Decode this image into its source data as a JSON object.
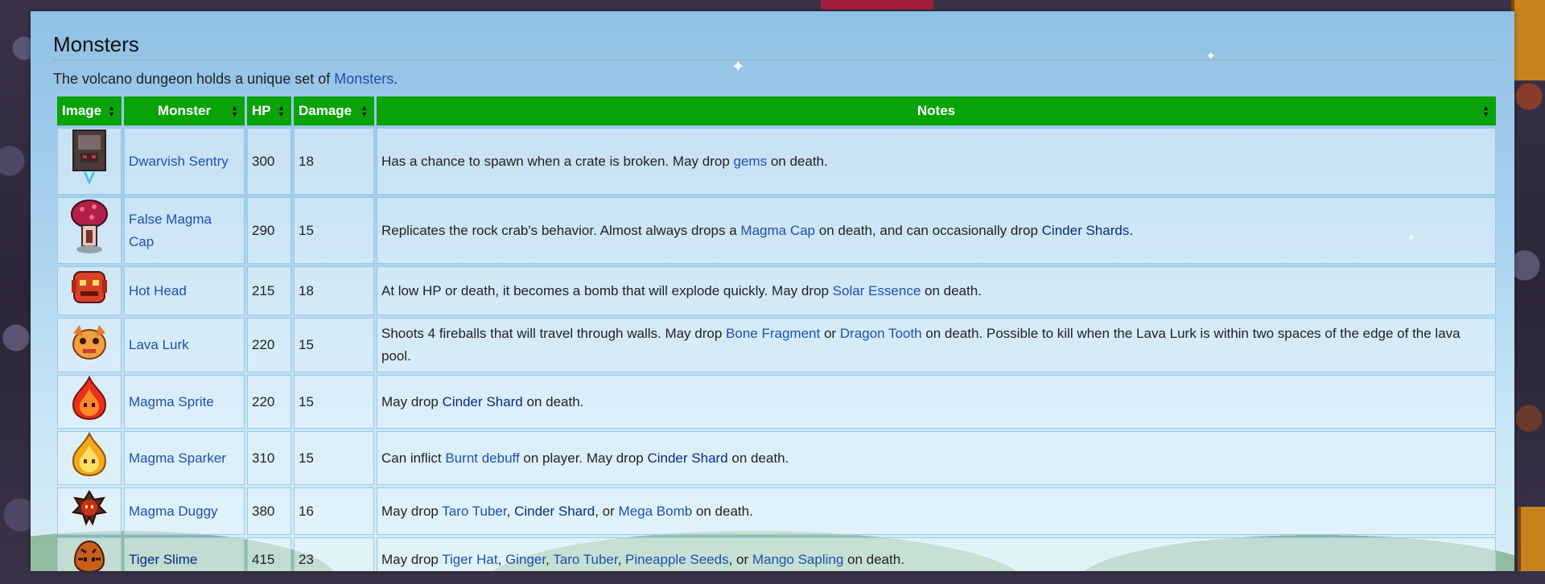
{
  "section": {
    "title": "Monsters",
    "intro_text": "The volcano dungeon holds a unique set of ",
    "intro_link": "Monsters",
    "intro_end": "."
  },
  "table": {
    "headers": {
      "image": "Image",
      "monster": "Monster",
      "hp": "HP",
      "damage": "Damage",
      "notes": "Notes"
    },
    "rows": [
      {
        "name": "Dwarvish Sentry",
        "hp": "300",
        "damage": "18",
        "icon": "dwarvish-sentry-sprite",
        "notes": [
          {
            "t": "Has a chance to spawn when a crate is broken. May drop "
          },
          {
            "t": "gems",
            "link": true
          },
          {
            "t": " on death."
          }
        ]
      },
      {
        "name": "False Magma Cap",
        "hp": "290",
        "damage": "15",
        "icon": "false-magma-cap-sprite",
        "notes": [
          {
            "t": "Replicates the rock crab's behavior. Almost always drops a "
          },
          {
            "t": "Magma Cap",
            "link": true
          },
          {
            "t": " on death, and can occasionally drop "
          },
          {
            "t": "Cinder Shards",
            "link": true,
            "dark": true
          },
          {
            "t": "."
          }
        ]
      },
      {
        "name": "Hot Head",
        "hp": "215",
        "damage": "18",
        "icon": "hot-head-sprite",
        "notes": [
          {
            "t": "At low HP or death, it becomes a bomb that will explode quickly. May drop "
          },
          {
            "t": "Solar Essence",
            "link": true
          },
          {
            "t": " on death."
          }
        ]
      },
      {
        "name": "Lava Lurk",
        "hp": "220",
        "damage": "15",
        "icon": "lava-lurk-sprite",
        "notes": [
          {
            "t": "Shoots 4 fireballs that will travel through walls. May drop "
          },
          {
            "t": "Bone Fragment",
            "link": true
          },
          {
            "t": " or "
          },
          {
            "t": "Dragon Tooth",
            "link": true
          },
          {
            "t": " on death. Possible to kill when the Lava Lurk is within two spaces of the edge of the lava pool."
          }
        ]
      },
      {
        "name": "Magma Sprite",
        "hp": "220",
        "damage": "15",
        "icon": "magma-sprite-sprite",
        "notes": [
          {
            "t": "May drop "
          },
          {
            "t": "Cinder Shard",
            "link": true,
            "dark": true
          },
          {
            "t": " on death."
          }
        ]
      },
      {
        "name": "Magma Sparker",
        "hp": "310",
        "damage": "15",
        "icon": "magma-sparker-sprite",
        "notes": [
          {
            "t": "Can inflict "
          },
          {
            "t": "Burnt debuff",
            "link": true
          },
          {
            "t": " on player. May drop "
          },
          {
            "t": "Cinder Shard",
            "link": true,
            "dark": true
          },
          {
            "t": " on death."
          }
        ]
      },
      {
        "name": "Magma Duggy",
        "hp": "380",
        "damage": "16",
        "icon": "magma-duggy-sprite",
        "notes": [
          {
            "t": "May drop "
          },
          {
            "t": "Taro Tuber",
            "link": true
          },
          {
            "t": ", "
          },
          {
            "t": "Cinder Shard",
            "link": true,
            "dark": true
          },
          {
            "t": ", or "
          },
          {
            "t": "Mega Bomb",
            "link": true
          },
          {
            "t": " on death."
          }
        ]
      },
      {
        "name": "Tiger Slime",
        "hp": "415",
        "damage": "23",
        "icon": "tiger-slime-sprite",
        "name_dark": true,
        "notes": [
          {
            "t": "May drop "
          },
          {
            "t": "Tiger Hat",
            "link": true
          },
          {
            "t": ", "
          },
          {
            "t": "Ginger",
            "link": true
          },
          {
            "t": ", "
          },
          {
            "t": "Taro Tuber",
            "link": true
          },
          {
            "t": ", "
          },
          {
            "t": "Pineapple Seeds",
            "link": true
          },
          {
            "t": ", or "
          },
          {
            "t": "Mango Sapling",
            "link": true
          },
          {
            "t": " on death."
          }
        ]
      }
    ]
  },
  "colors": {
    "header_green": "#0aa30a",
    "link_blue": "#1e50b4",
    "link_dark": "#0b2a80"
  }
}
